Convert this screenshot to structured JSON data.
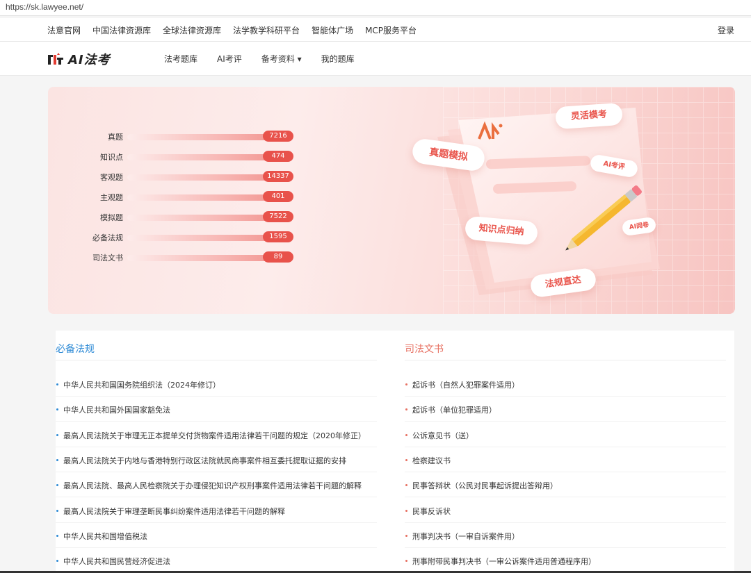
{
  "browser": {
    "url": "https://sk.lawyee.net/"
  },
  "topnav": {
    "links": [
      "法意官网",
      "中国法律资源库",
      "全球法律资源库",
      "法学教学科研平台",
      "智能体广场",
      "MCP服务平台"
    ],
    "login": "登录"
  },
  "header": {
    "logo_text": "AI法考",
    "nav": [
      "法考题库",
      "AI考评",
      "备考资料 ▾",
      "我的题库"
    ]
  },
  "hero": {
    "stats": [
      {
        "label": "真题",
        "count": "7216"
      },
      {
        "label": "知识点",
        "count": "474"
      },
      {
        "label": "客观题",
        "count": "14337"
      },
      {
        "label": "主观题",
        "count": "401"
      },
      {
        "label": "模拟题",
        "count": "7522"
      },
      {
        "label": "必备法规",
        "count": "1595"
      },
      {
        "label": "司法文书",
        "count": "89"
      }
    ],
    "tags": {
      "flexible": "灵活模考",
      "real": "真题模拟",
      "ai_eval": "AI考评",
      "knowledge": "知识点归纳",
      "ai_grade": "AI阅卷",
      "law": "法规直达"
    }
  },
  "sections": {
    "laws": {
      "title": "必备法规",
      "items": [
        "中华人民共和国国务院组织法（2024年修订）",
        "中华人民共和国外国国家豁免法",
        "最高人民法院关于审理无正本提单交付货物案件适用法律若干问题的规定（2020年修正）",
        "最高人民法院关于内地与香港特别行政区法院就民商事案件相互委托提取证据的安排",
        "最高人民法院、最高人民检察院关于办理侵犯知识产权刑事案件适用法律若干问题的解释",
        "最高人民法院关于审理垄断民事纠纷案件适用法律若干问题的解释",
        "中华人民共和国增值税法",
        "中华人民共和国民营经济促进法"
      ]
    },
    "docs": {
      "title": "司法文书",
      "items": [
        "起诉书（自然人犯罪案件适用）",
        "起诉书（单位犯罪适用）",
        "公诉意见书（送）",
        "检察建议书",
        "民事答辩状（公民对民事起诉提出答辩用）",
        "民事反诉状",
        "刑事判决书（一审自诉案件用）",
        "刑事附带民事判决书（一审公诉案件适用普通程序用）"
      ]
    }
  },
  "colors": {
    "brand_red": "#e8524b",
    "law_blue": "#2f8bd6",
    "doc_red": "#e77062"
  }
}
